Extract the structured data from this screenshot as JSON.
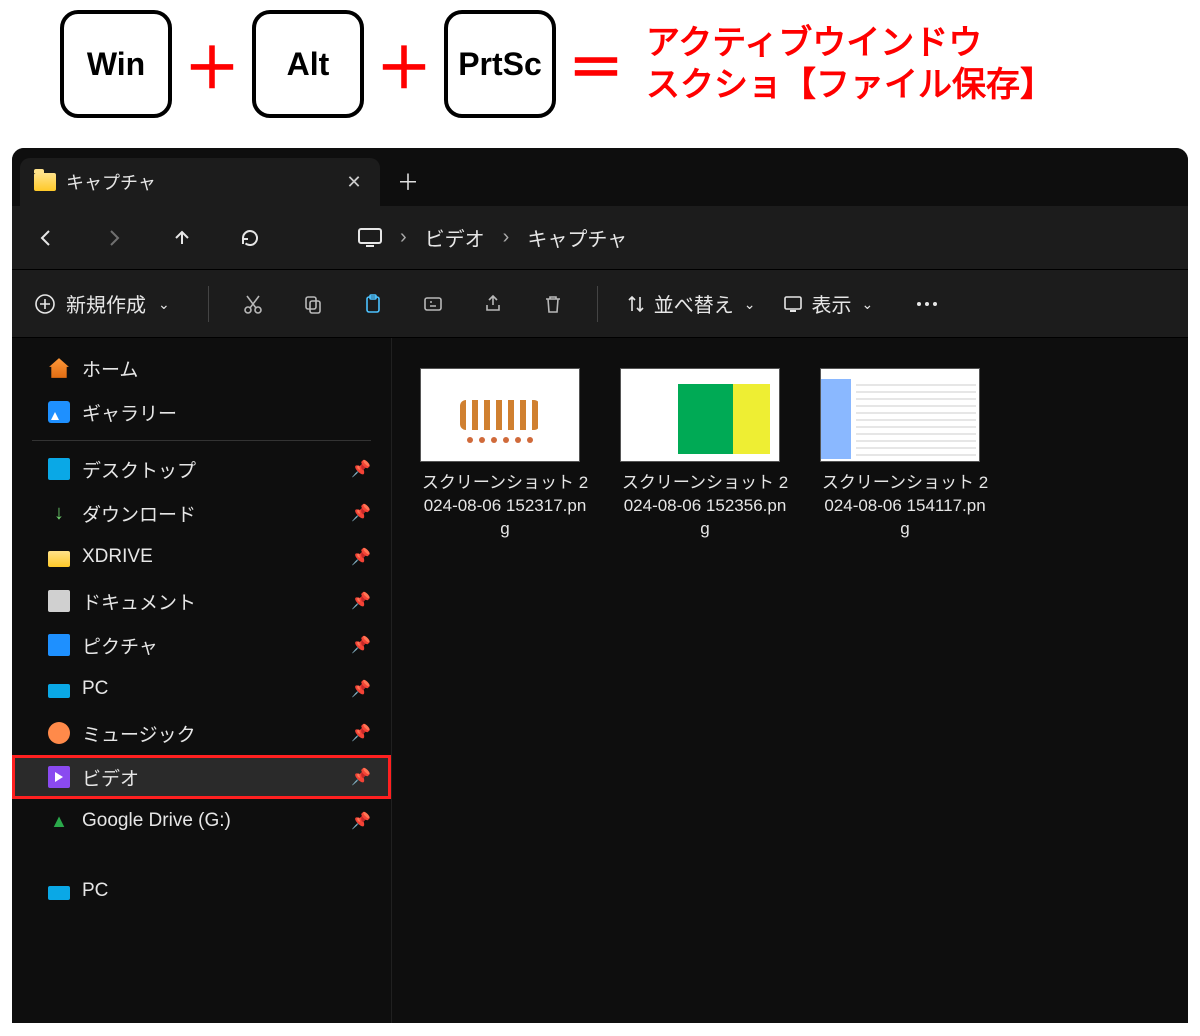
{
  "shortcut": {
    "key1": "Win",
    "key2": "Alt",
    "key3": "PrtSc",
    "plus": "＋",
    "equals": "＝",
    "line1": "アクティブウインドウ",
    "line2": "スクショ【ファイル保存】"
  },
  "tab": {
    "title": "キャプチャ"
  },
  "breadcrumb": {
    "seg1": "ビデオ",
    "seg2": "キャプチャ",
    "sep": "›"
  },
  "toolbar": {
    "new_label": "新規作成",
    "sort_label": "並べ替え",
    "view_label": "表示"
  },
  "sidebar": {
    "home": "ホーム",
    "gallery": "ギャラリー",
    "desktop": "デスクトップ",
    "downloads": "ダウンロード",
    "xdrive": "XDRIVE",
    "documents": "ドキュメント",
    "pictures": "ピクチャ",
    "pc1": "PC",
    "music": "ミュージック",
    "video": "ビデオ",
    "gdrive": "Google Drive (G:)",
    "pc2": "PC"
  },
  "files": [
    {
      "name": "スクリーンショット 2024-08-06 152317.png"
    },
    {
      "name": "スクリーンショット 2024-08-06 152356.png"
    },
    {
      "name": "スクリーンショット 2024-08-06 154117.png"
    }
  ]
}
